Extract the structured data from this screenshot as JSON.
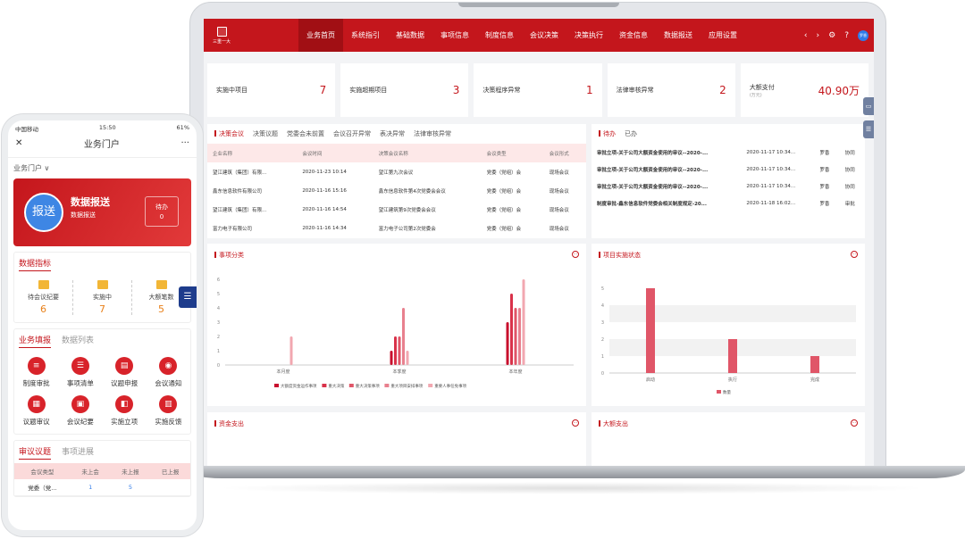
{
  "laptop": {
    "logo_text": "三重一大",
    "nav": [
      "业务首页",
      "系统指引",
      "基础数据",
      "事项信息",
      "制度信息",
      "会议决策",
      "决策执行",
      "资金信息",
      "数据报送",
      "应用设置"
    ],
    "nav_right": [
      "‹",
      "›",
      "⚙",
      "?",
      "罗香"
    ],
    "kpis": [
      {
        "label": "实施中项目",
        "value": "7",
        "sub": ""
      },
      {
        "label": "实施超期项目",
        "value": "3",
        "sub": ""
      },
      {
        "label": "决策程序异常",
        "value": "1",
        "sub": ""
      },
      {
        "label": "法律审核异常",
        "value": "2",
        "sub": ""
      },
      {
        "label": "大额支付",
        "value": "40.90万",
        "sub": "(万元)"
      }
    ],
    "meeting_tabs": [
      "决策会议",
      "决策议题",
      "党委会未前置",
      "会议召开异常",
      "表决异常",
      "法律审核异常"
    ],
    "meeting_cols": [
      "企业名称",
      "会议时间",
      "决策会议名称",
      "会议类型",
      "会议形式"
    ],
    "meeting_rows": [
      [
        "望江建筑（集团）有限...",
        "2020-11-23 10:14",
        "望江第九次会议",
        "党委（党组）会",
        "现场会议"
      ],
      [
        "鑫东信息软件有限公司",
        "2020-11-16 15:16",
        "鑫东信息软件第4次党委会会议",
        "党委（党组）会",
        "现场会议"
      ],
      [
        "望江建筑（集团）有限...",
        "2020-11-16 14:54",
        "望江建筑第9次党委会会议",
        "党委（党组）会",
        "现场会议"
      ],
      [
        "富力电子有限公司",
        "2020-11-16 14:34",
        "富力电子公司第2次党委会",
        "党委（党组）会",
        "现场会议"
      ]
    ],
    "todo_tabs": [
      "待办",
      "已办"
    ],
    "todo_rows": [
      [
        "审批立项-关于公司大额资金使用的审议--2020-...",
        "2020-11-17 10:34...",
        "罗香",
        "协同"
      ],
      [
        "审批立项-关于公司大额资金使用的审议--2020-...",
        "2020-11-17 10:34...",
        "罗香",
        "协同"
      ],
      [
        "审批立项-关于公司大额资金使用的审议--2020-...",
        "2020-11-17 10:34...",
        "罗香",
        "协同"
      ],
      [
        "制度审批-鑫东信息软件党委会相关制度规定-20...",
        "2020-11-18 16:02...",
        "罗香",
        "审批"
      ]
    ],
    "chart1_title": "事项分类",
    "chart2_title": "项目实施状态",
    "panel3_title": "资金支出",
    "panel4_title": "大额支出",
    "accent": "#c4161c"
  },
  "chart_data": [
    {
      "type": "bar",
      "title": "事项分类",
      "categories": [
        "本月度",
        "本季度",
        "本年度"
      ],
      "ylim": [
        0,
        6
      ],
      "series": [
        {
          "name": "大额度资金运作事项",
          "color": "#c8102e",
          "values": [
            0,
            1,
            3
          ]
        },
        {
          "name": "重大决策",
          "color": "#d9324a",
          "values": [
            0,
            2,
            5
          ]
        },
        {
          "name": "重大决策事项",
          "color": "#e05668",
          "values": [
            0,
            2,
            4
          ]
        },
        {
          "name": "重大项目安排事项",
          "color": "#e8808e",
          "values": [
            0,
            4,
            4
          ]
        },
        {
          "name": "重要人事任免事项",
          "color": "#f2a7b0",
          "values": [
            2,
            1,
            6
          ]
        }
      ]
    },
    {
      "type": "bar",
      "title": "项目实施状态",
      "categories": [
        "启动",
        "执行",
        "完成"
      ],
      "ylim": [
        0,
        5
      ],
      "series": [
        {
          "name": "数量",
          "color": "#e05668",
          "values": [
            5,
            2,
            1
          ]
        }
      ]
    }
  ],
  "phone": {
    "status_left": "中国移动",
    "status_time": "15:50",
    "status_right": "61%",
    "close": "✕",
    "title": "业务门户",
    "more": "···",
    "sub": "业务门户 ∨",
    "banner_icon": "报送",
    "banner_title": "数据报送",
    "banner_sub": "数据报送",
    "banner_pend_label": "待办",
    "banner_pend_value": "0",
    "metrics_title": "数据指标",
    "stats": [
      {
        "label": "待会议纪要",
        "value": "6"
      },
      {
        "label": "实施中",
        "value": "7"
      },
      {
        "label": "大额笔数",
        "value": "5"
      }
    ],
    "biz_tabs": [
      "业务填报",
      "数据列表"
    ],
    "grid": [
      "制度审批",
      "事项清单",
      "议题申报",
      "会议通知",
      "议题审议",
      "会议纪要",
      "实施立项",
      "实施反馈"
    ],
    "review_tabs": [
      "审议议题",
      "事项进展"
    ],
    "table_cols": [
      "会议类型",
      "未上会",
      "未上报",
      "已上报"
    ],
    "table_rows": [
      [
        "党委（党...",
        "1",
        "5",
        ""
      ]
    ],
    "menu_icon": "☰"
  }
}
